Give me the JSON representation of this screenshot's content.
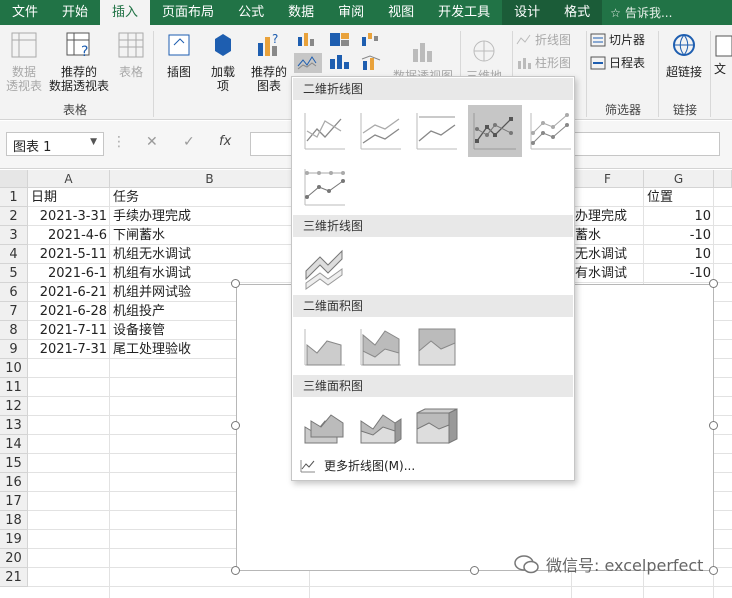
{
  "tabs": [
    "文件",
    "开始",
    "插入",
    "页面布局",
    "公式",
    "数据",
    "审阅",
    "视图",
    "开发工具",
    "设计",
    "格式"
  ],
  "tell": "告诉我...",
  "ribbon": {
    "pivot": "数据\n透视表",
    "rec_pivot": "推荐的\n数据透视表",
    "table": "表格",
    "group_tables": "表格",
    "illus": "插图",
    "addins": "加载\n项",
    "rec_chart": "推荐的\n图表",
    "pivotchart": "数据透视图",
    "map3d": "三维地",
    "spark_line": "折线图",
    "spark_col": "柱形图",
    "slicer": "切片器",
    "timeline": "日程表",
    "group_filter": "筛选器",
    "link": "超链接",
    "group_link": "链接",
    "text_trunc": "文"
  },
  "formula": {
    "namebox": "图表 1",
    "fx": "fx"
  },
  "columns": [
    "A",
    "B",
    "F",
    "G"
  ],
  "rows": [
    "1",
    "2",
    "3",
    "4",
    "5",
    "6",
    "7",
    "8",
    "9",
    "10",
    "11",
    "12",
    "13",
    "14",
    "15",
    "16",
    "17",
    "18",
    "19",
    "20",
    "21"
  ],
  "cellsA": [
    "日期",
    "2021-3-31",
    "2021-4-6",
    "2021-5-11",
    "2021-6-1",
    "2021-6-21",
    "2021-6-28",
    "2021-7-11",
    "2021-7-31"
  ],
  "cellsB": [
    "任务",
    "手续办理完成",
    "下闸蓄水",
    "机组无水调试",
    "机组有水调试",
    "机组并网试验",
    "机组投产",
    "设备接管",
    "尾工处理验收"
  ],
  "cellsF": [
    "",
    "办理完成",
    "蓄水",
    "无水调试",
    "有水调试"
  ],
  "cellsG": [
    "位置",
    "10",
    "-10",
    "10",
    "-10"
  ],
  "dropdown": {
    "sec1": "二维折线图",
    "sec2": "三维折线图",
    "sec3": "二维面积图",
    "sec4": "三维面积图",
    "more": "更多折线图(M)..."
  },
  "watermark": "微信号: excelperfect",
  "colors": {
    "excel_green": "#217346",
    "accent": "#217346"
  }
}
